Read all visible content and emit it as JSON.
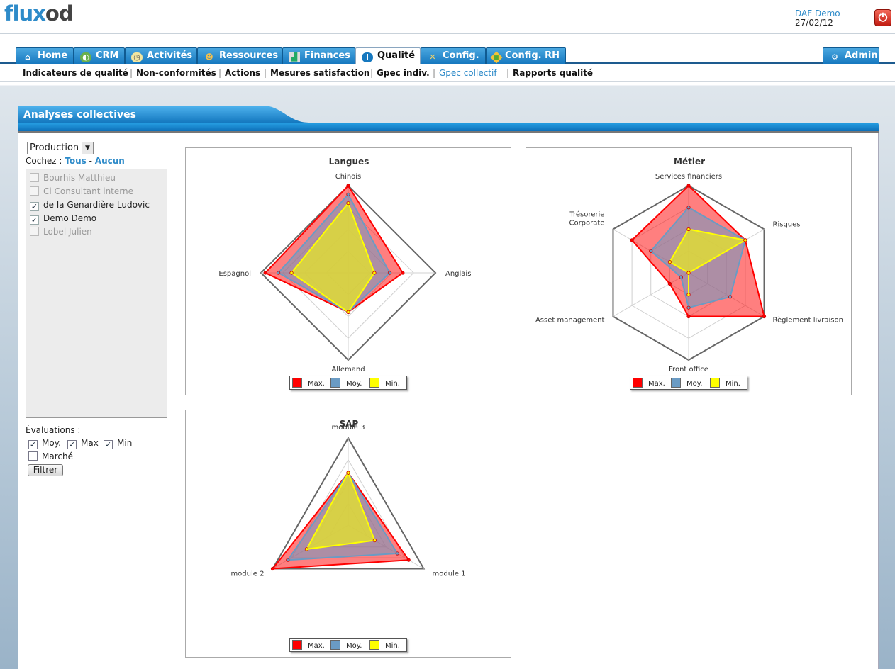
{
  "app": {
    "logo_part1": "flu",
    "logo_part2": "x",
    "logo_part3": "od"
  },
  "user": {
    "name": "DAF Demo",
    "date": "27/02/12"
  },
  "nav": {
    "tabs": [
      {
        "label": "Home",
        "icon": "home-icon"
      },
      {
        "label": "CRM",
        "icon": "globe-icon"
      },
      {
        "label": "Activités",
        "icon": "clock-icon"
      },
      {
        "label": "Ressources",
        "icon": "people-icon"
      },
      {
        "label": "Finances",
        "icon": "chart-icon"
      },
      {
        "label": "Qualité",
        "icon": "info-icon",
        "active": true
      },
      {
        "label": "Config.",
        "icon": "tools-icon"
      },
      {
        "label": "Config. RH",
        "icon": "badge-icon"
      }
    ],
    "admin": "Admin"
  },
  "subnav": {
    "items": [
      "Indicateurs de qualité",
      "Non-conformités",
      "Actions",
      "Mesures satisfaction",
      "Gpec indiv.",
      "Gpec collectif",
      "Rapports qualité"
    ],
    "active_index": 5
  },
  "panel": {
    "title": "Analyses collectives"
  },
  "sidebar": {
    "group": "Production",
    "check_prefix": "Cochez : ",
    "check_all": "Tous",
    "check_sep": " - ",
    "check_none": "Aucun",
    "people": [
      {
        "name": "Bourhis Matthieu",
        "checked": false,
        "enabled": false
      },
      {
        "name": "Ci Consultant interne",
        "checked": false,
        "enabled": false
      },
      {
        "name": "de la Genardière Ludovic",
        "checked": true,
        "enabled": true
      },
      {
        "name": "Demo Demo",
        "checked": true,
        "enabled": true
      },
      {
        "name": "Lobel Julien",
        "checked": false,
        "enabled": false
      }
    ],
    "evaluations_title": "Évaluations :",
    "eval_moy": "Moy.",
    "eval_max": "Max",
    "eval_min": "Min",
    "eval_marche": "Marché",
    "filter_button": "Filtrer"
  },
  "colors": {
    "max": "#ff0000",
    "moy": "#6a9bc4",
    "min": "#ffff00",
    "accent": "#2e8bc9"
  },
  "chart_data": [
    {
      "type": "radar",
      "title": "Langues",
      "axes": [
        "Chinois",
        "Anglais",
        "Allemand",
        "Espagnol"
      ],
      "max_value": 4,
      "series": [
        {
          "name": "Max.",
          "values": [
            4,
            2.5,
            1.8,
            3.8
          ]
        },
        {
          "name": "Moy.",
          "values": [
            3.6,
            1.9,
            1.8,
            3.2
          ]
        },
        {
          "name": "Min.",
          "values": [
            3.2,
            1.2,
            1.8,
            2.6
          ]
        }
      ],
      "legend": [
        "Max.",
        "Moy.",
        "Min."
      ]
    },
    {
      "type": "radar",
      "title": "Métier",
      "axes": [
        "Services financiers",
        "Risques",
        "Règlement livraison",
        "Front office",
        "Asset management",
        "Trésorerie Corporate"
      ],
      "axis_labels_multiline": [
        [
          "Services financiers"
        ],
        [
          "Risques"
        ],
        [
          "Règlement livraison"
        ],
        [
          "Front office"
        ],
        [
          "Asset management"
        ],
        [
          "Trésorerie",
          "Corporate"
        ]
      ],
      "max_value": 4,
      "series": [
        {
          "name": "Max.",
          "values": [
            4,
            3,
            4,
            2,
            1,
            3
          ]
        },
        {
          "name": "Moy.",
          "values": [
            3,
            3,
            2.2,
            1.6,
            0.4,
            2
          ]
        },
        {
          "name": "Min.",
          "values": [
            2,
            3,
            0,
            1,
            0,
            1
          ]
        }
      ],
      "legend": [
        "Max.",
        "Moy.",
        "Min."
      ]
    },
    {
      "type": "radar",
      "title": "SAP",
      "axes": [
        "module 3",
        "module 1",
        "module 2"
      ],
      "max_value": 4,
      "series": [
        {
          "name": "Max.",
          "values": [
            2.4,
            3.2,
            4
          ]
        },
        {
          "name": "Moy.",
          "values": [
            2.4,
            2.6,
            3.2
          ]
        },
        {
          "name": "Min.",
          "values": [
            2.4,
            1.4,
            2.2
          ]
        }
      ],
      "legend": [
        "Max.",
        "Moy.",
        "Min."
      ]
    }
  ]
}
